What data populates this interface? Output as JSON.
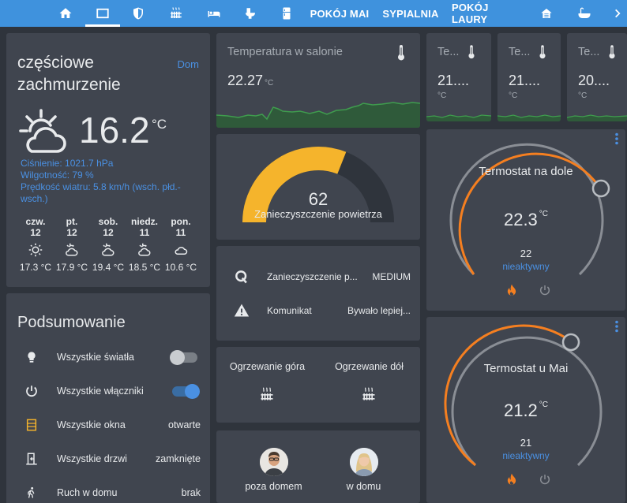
{
  "topbar": {
    "tabs": [
      {
        "icon": "home-icon"
      },
      {
        "icon": "overview-icon",
        "active": true
      },
      {
        "icon": "shield-icon"
      },
      {
        "icon": "radiator-icon"
      },
      {
        "icon": "bed-icon"
      },
      {
        "icon": "toilet-icon"
      },
      {
        "icon": "fridge-icon"
      }
    ],
    "text_tabs": [
      "POKÓJ MAI",
      "SYPIALNIA",
      "POKÓJ LAURY"
    ],
    "trailing_icons": [
      "house-icon",
      "bathtub-icon",
      "chevron-right-icon"
    ]
  },
  "weather": {
    "condition": "częściowe zachmurzenie",
    "location": "Dom",
    "temperature": "16.2",
    "unit": "°C",
    "pressure": "Ciśnienie: 1021.7 hPa",
    "humidity": "Wilgotność: 79 %",
    "wind": "Prędkość wiatru: 5.8 km/h (wsch. płd.-wsch.)",
    "forecast": [
      {
        "day": "czw.",
        "date": "12",
        "icon": "sunny-icon",
        "temp": "17.3 °C"
      },
      {
        "day": "pt.",
        "date": "12",
        "icon": "partly-cloudy-icon",
        "temp": "17.9 °C"
      },
      {
        "day": "sob.",
        "date": "12",
        "icon": "partly-cloudy-icon",
        "temp": "19.4 °C"
      },
      {
        "day": "niedz.",
        "date": "11",
        "icon": "partly-cloudy-icon",
        "temp": "18.5 °C"
      },
      {
        "day": "pon.",
        "date": "11",
        "icon": "cloudy-icon",
        "temp": "10.6 °C"
      }
    ]
  },
  "summary": {
    "title": "Podsumowanie",
    "rows": [
      {
        "icon": "lightbulb-icon",
        "label": "Wszystkie światła",
        "type": "toggle",
        "on": false
      },
      {
        "icon": "power-icon",
        "label": "Wszystkie włączniki",
        "type": "toggle",
        "on": true
      },
      {
        "icon": "window-icon",
        "label": "Wszystkie okna",
        "value": "otwarte"
      },
      {
        "icon": "door-icon",
        "label": "Wszystkie drzwi",
        "value": "zamknięte"
      },
      {
        "icon": "walk-icon",
        "label": "Ruch w domu",
        "value": "brak"
      }
    ]
  },
  "salon": {
    "title": "Temperatura w salonie",
    "value": "22.27",
    "unit": "°C"
  },
  "small_sensors": [
    {
      "title": "Te...",
      "value": "21....",
      "unit": "°C"
    },
    {
      "title": "Te...",
      "value": "21....",
      "unit": "°C"
    },
    {
      "title": "Te...",
      "value": "20....",
      "unit": "°C"
    }
  ],
  "air_gauge": {
    "value": "62",
    "value_num": 62,
    "label": "Zanieczyszczenie powietrza",
    "color": "#f5b42c",
    "track_color": "#2f343c"
  },
  "entities": [
    {
      "icon": "q-icon",
      "label": "Zanieczyszczenie p...",
      "value": "MEDIUM"
    },
    {
      "icon": "alert-icon",
      "label": "Komunikat",
      "value": "Bywało lepiej..."
    }
  ],
  "heating": [
    {
      "label": "Ogrzewanie góra",
      "icon": "radiator-icon"
    },
    {
      "label": "Ogrzewanie dół",
      "icon": "radiator-icon"
    }
  ],
  "people": [
    {
      "label": "poza domem",
      "avatar": "man"
    },
    {
      "label": "w domu",
      "avatar": "woman"
    }
  ],
  "thermostats": [
    {
      "name": "Termostat na dole",
      "temp": "22.3",
      "unit": "°C",
      "setpoint": "22",
      "state": "nieaktywny"
    },
    {
      "name": "Termostat u Mai",
      "temp": "21.2",
      "unit": "°C",
      "setpoint": "21",
      "state": "nieaktywny"
    }
  ],
  "colors": {
    "accent": "#3f92dd",
    "link": "#4a90e2",
    "heat": "#f57f20",
    "toggle_on": "#4a90e2",
    "window": "#f5b42c",
    "graph": "#3f9c4e"
  }
}
